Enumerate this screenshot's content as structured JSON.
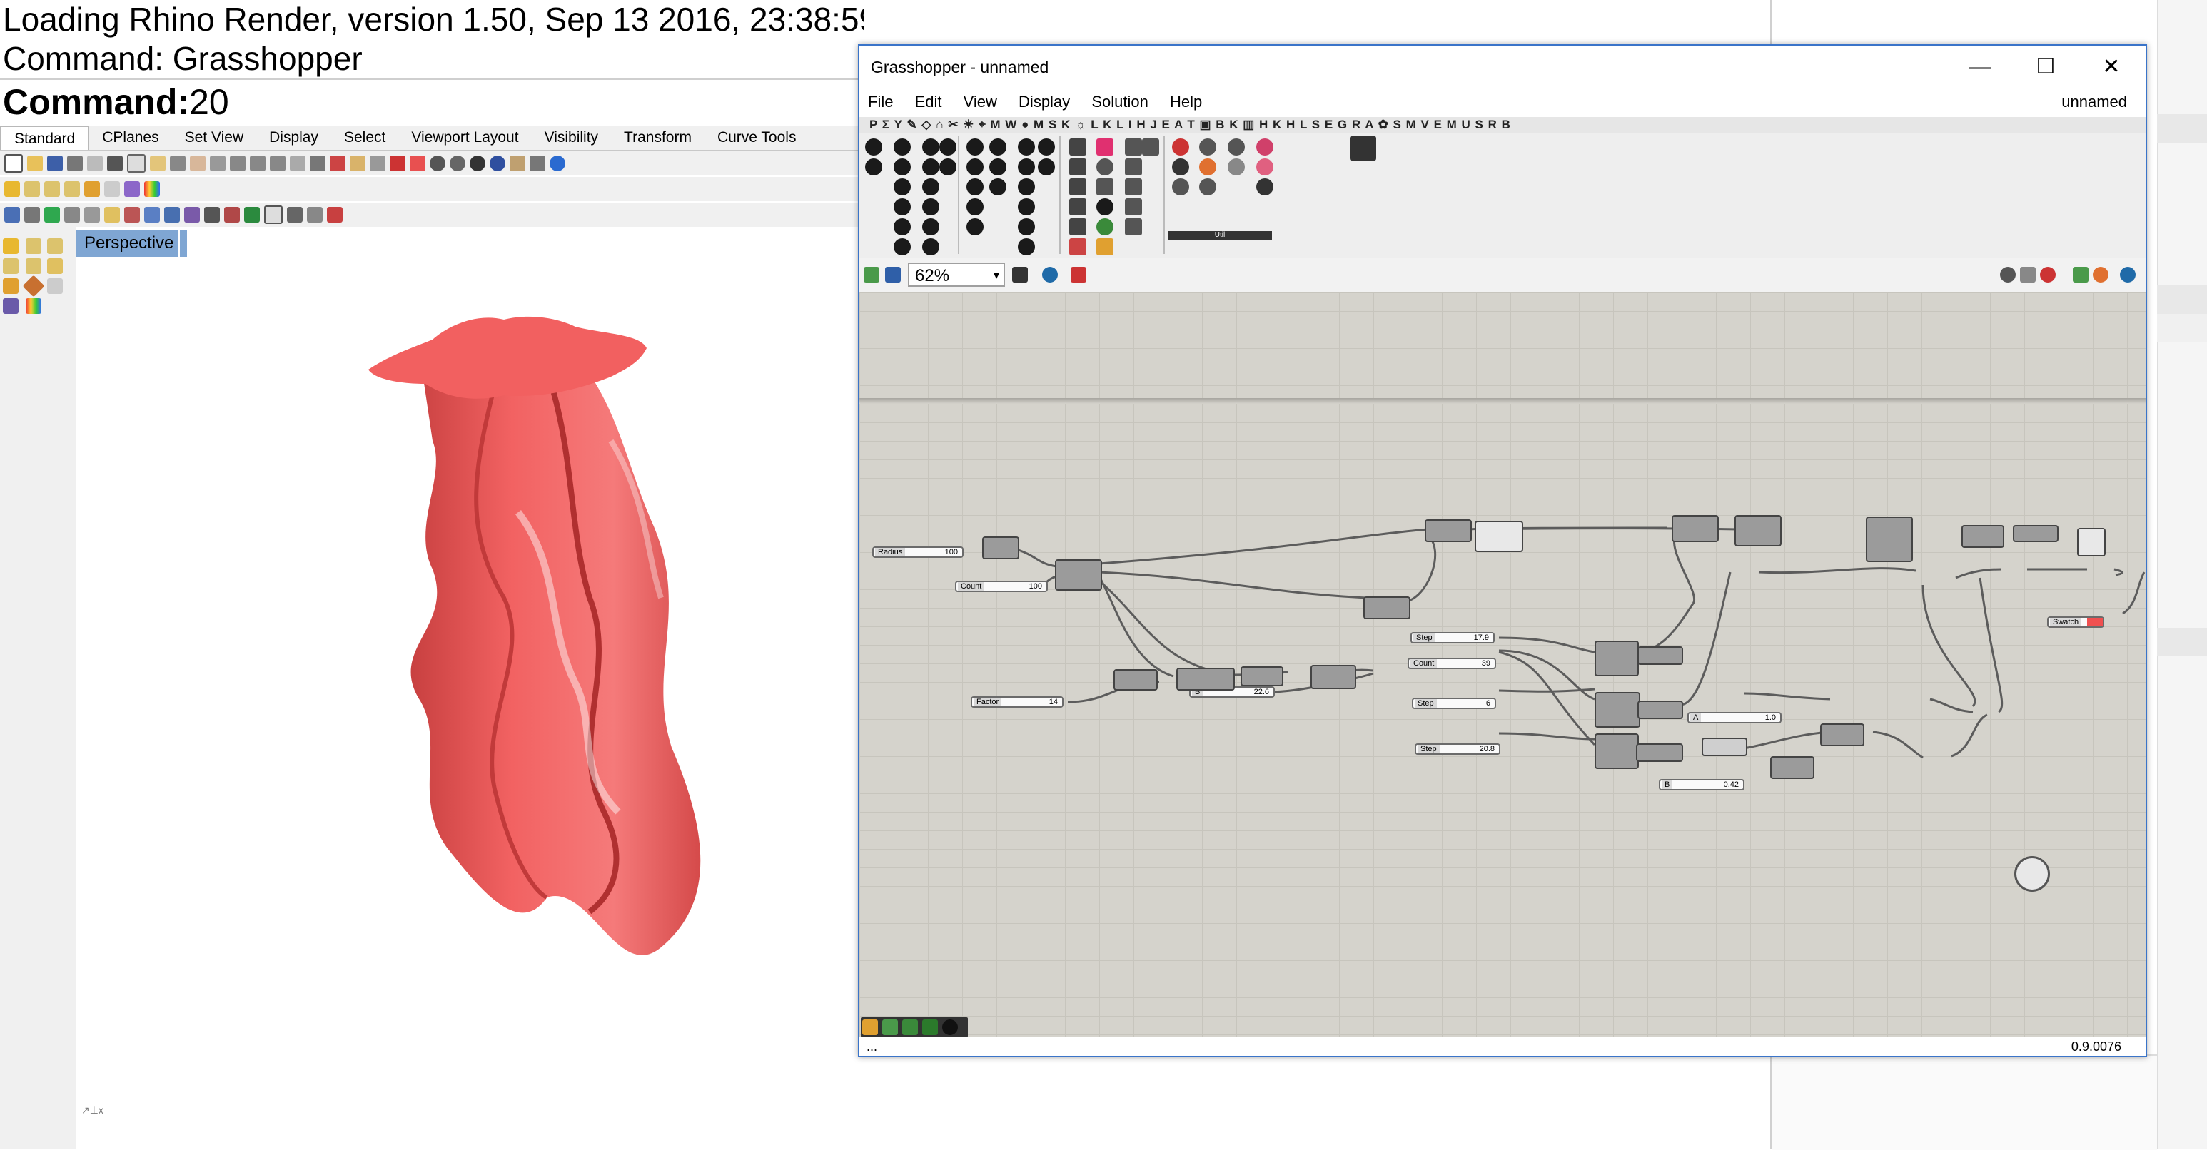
{
  "rhino": {
    "history": [
      "Loading Rhino Render, version 1.50, Sep 13 2016, 23:38:59",
      "Command: Grasshopper"
    ],
    "command_prompt": "Command:",
    "command_value": "20",
    "tabs": [
      "Standard",
      "CPlanes",
      "Set View",
      "Display",
      "Select",
      "Viewport Layout",
      "Visibility",
      "Transform",
      "Curve Tools"
    ],
    "viewport_name": "Perspective",
    "object_color": "#f05b5b"
  },
  "grasshopper": {
    "title": "Grasshopper - unnamed",
    "menu": [
      "File",
      "Edit",
      "View",
      "Display",
      "Solution",
      "Help"
    ],
    "document_name": "unnamed",
    "component_tabs": "P Σ Y ✎ ◇ ⌂ ✂ ☀ ⌖ M W ● M S K ☼ L K L I H J E A T ▣ B K ▥ H K H L S E G R A ✿ S M V E M U S R B",
    "zoom": "62%",
    "status_left": "...",
    "version": "0.9.0076",
    "sliders": [
      {
        "label": "Radius",
        "value": "100"
      },
      {
        "label": "Count",
        "value": "100"
      },
      {
        "label": "Factor",
        "value": "14"
      },
      {
        "label": "B",
        "value": "22.6"
      },
      {
        "label": "Step",
        "value": "17.9"
      },
      {
        "label": "Count",
        "value": "39"
      },
      {
        "label": "Step",
        "value": "6"
      },
      {
        "label": "Step",
        "value": "20.8"
      },
      {
        "label": "A",
        "value": "1.0"
      },
      {
        "label": "B",
        "value": "0.42"
      }
    ],
    "swatch_label": "Swatch",
    "ribbon_panel_label": "Util"
  }
}
